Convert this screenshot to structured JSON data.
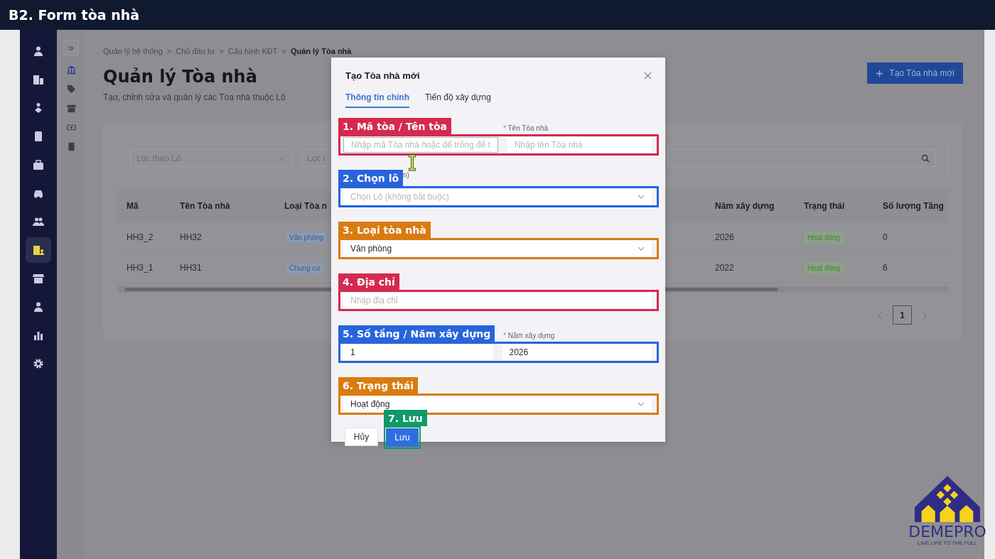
{
  "banner": {
    "title": "B2. Form tòa nhà"
  },
  "sidebar": {
    "items": [
      {
        "selected": false
      },
      {
        "selected": false
      },
      {
        "selected": false
      },
      {
        "selected": false
      },
      {
        "selected": false
      },
      {
        "selected": false
      },
      {
        "selected": false
      },
      {
        "selected": true
      },
      {
        "selected": false
      },
      {
        "selected": false
      },
      {
        "selected": false
      },
      {
        "selected": false
      }
    ]
  },
  "subnav": {
    "expand": "»",
    "items": [
      {
        "selected": true
      },
      {
        "selected": false
      },
      {
        "selected": false
      },
      {
        "selected": false
      },
      {
        "selected": false
      }
    ]
  },
  "breadcrumb": {
    "separator": ">",
    "items": [
      {
        "label": "Quản lý hệ thống",
        "current": false
      },
      {
        "label": "Chủ đầu tư",
        "current": false
      },
      {
        "label": "Cấu hình KĐT",
        "current": false
      },
      {
        "label": "Quản lý Tòa nhà",
        "current": true
      }
    ]
  },
  "page": {
    "title": "Quản lý Tòa nhà",
    "subtitle": "Tạo, chỉnh sửa và quản lý các Tòa nhà thuộc Lô",
    "create_button": "Tạo Tòa nhà mới"
  },
  "filters": [
    {
      "kind": "select",
      "placeholder": "Lọc theo Lô"
    },
    {
      "kind": "text",
      "placeholder": "Lọc t"
    },
    {
      "kind": "search"
    }
  ],
  "table": {
    "columns": [
      "Mã",
      "Tên Tòa nhà",
      "Loại Tòa n",
      "Năm xây dựng",
      "Trạng thái",
      "Số lượng Tầng"
    ],
    "rows": [
      {
        "code": "HH3_2",
        "name": "HH32",
        "type": "Văn phòng",
        "year": "2026",
        "status": "Hoạt động",
        "floors": "0"
      },
      {
        "code": "HH3_1",
        "name": "HH31",
        "type": "Chung cư",
        "year": "2022",
        "status": "Hoạt động",
        "floors": "6"
      }
    ]
  },
  "pagination": {
    "pages": [
      {
        "label": "1",
        "selected": true
      }
    ]
  },
  "modal": {
    "title": "Tạo Tòa nhà mới",
    "tabs": [
      {
        "label": "Thông tin chính",
        "selected": true
      },
      {
        "label": "Tiến độ xây dựng",
        "selected": false
      }
    ],
    "groups": [
      {
        "tag": "1. Mã tòa / Tên tòa",
        "color": "#d42a50",
        "fields": [
          {
            "kind": "input",
            "placeholder": "Nhập mã Tòa nhà hoặc để trống để t"
          },
          {
            "kind": "input",
            "label": "Tên Tòa nhà",
            "mark": "*",
            "placeholder": "Nhập tên Tòa nhà"
          }
        ]
      },
      {
        "tag": "2. Chọn lô",
        "color": "#2864dc",
        "fields": [
          {
            "kind": "select",
            "label": "n)",
            "placeholder": "Chọn Lô (không bắt buộc)"
          }
        ]
      },
      {
        "tag": "3. Loại tòa nhà",
        "color": "#d97b10",
        "fields": [
          {
            "kind": "select",
            "value": "Văn phòng"
          }
        ]
      },
      {
        "tag": "4. Địa chỉ",
        "color": "#d42a50",
        "fields": [
          {
            "kind": "input",
            "placeholder": "Nhập địa chỉ"
          }
        ]
      },
      {
        "tag": "5. Số tầng / Năm xây dựng",
        "color": "#2864dc",
        "fields": [
          {
            "kind": "input",
            "value": "1"
          },
          {
            "kind": "input",
            "label": "Năm xây dựng",
            "mark": "*",
            "value": "2026"
          }
        ]
      },
      {
        "tag": "6. Trạng thái",
        "color": "#d97b10",
        "fields": [
          {
            "kind": "select",
            "value": "Hoạt động"
          }
        ]
      }
    ],
    "cancel": "Hủy",
    "save": "Lưu",
    "save_tag": {
      "tag": "7. Lưu",
      "color": "#0f9a66"
    }
  },
  "logo": {
    "name": "DEMEPRO",
    "tagline": "LIVE LIFE TO THE FULL"
  }
}
